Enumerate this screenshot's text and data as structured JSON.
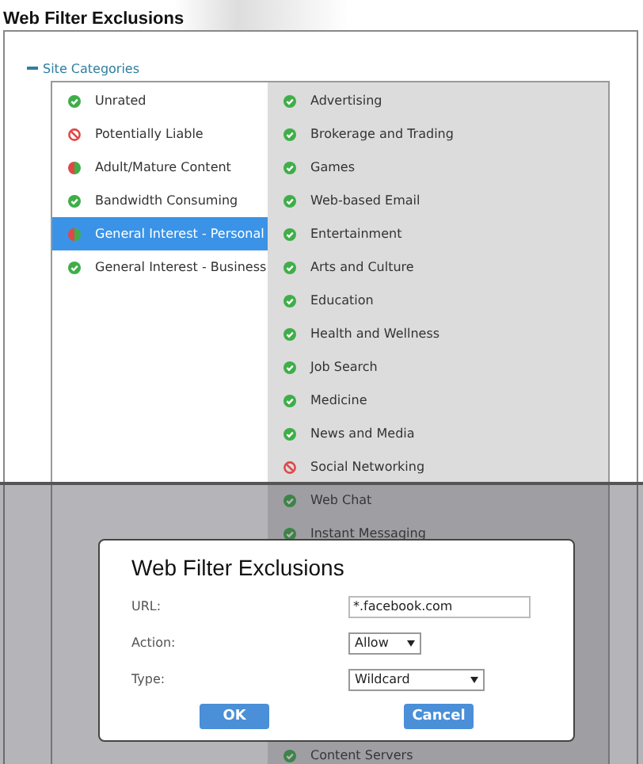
{
  "page_title": "Web Filter Exclusions",
  "section": {
    "title": "Site Categories",
    "expanded": true
  },
  "left_items": [
    {
      "label": "Unrated",
      "kind": "allowed",
      "selected": false
    },
    {
      "label": "Potentially Liable",
      "kind": "blocked",
      "selected": false
    },
    {
      "label": "Adult/Mature Content",
      "kind": "mixed",
      "selected": false
    },
    {
      "label": "Bandwidth Consuming",
      "kind": "allowed",
      "selected": false
    },
    {
      "label": "General Interest - Personal",
      "kind": "mixed",
      "selected": true
    },
    {
      "label": "General Interest - Business",
      "kind": "allowed",
      "selected": false
    }
  ],
  "right_items": [
    {
      "label": "Advertising",
      "kind": "allowed"
    },
    {
      "label": "Brokerage and Trading",
      "kind": "allowed"
    },
    {
      "label": "Games",
      "kind": "allowed"
    },
    {
      "label": "Web-based Email",
      "kind": "allowed"
    },
    {
      "label": "Entertainment",
      "kind": "allowed"
    },
    {
      "label": "Arts and Culture",
      "kind": "allowed"
    },
    {
      "label": "Education",
      "kind": "allowed"
    },
    {
      "label": "Health and Wellness",
      "kind": "allowed"
    },
    {
      "label": "Job Search",
      "kind": "allowed"
    },
    {
      "label": "Medicine",
      "kind": "allowed"
    },
    {
      "label": "News and Media",
      "kind": "allowed"
    },
    {
      "label": "Social Networking",
      "kind": "blocked"
    },
    {
      "label": "Web Chat",
      "kind": "allowed"
    },
    {
      "label": "Instant Messaging",
      "kind": "allowed"
    }
  ],
  "right_items_below_dialog": [
    {
      "label": "Content Servers",
      "kind": "allowed"
    }
  ],
  "dialog": {
    "title": "Web Filter Exclusions",
    "fields": [
      {
        "label": "URL:",
        "kind": "text",
        "value": "*.facebook.com"
      },
      {
        "label": "Action:",
        "kind": "select",
        "value": "Allow"
      },
      {
        "label": "Type:",
        "kind": "select",
        "value": "Wildcard"
      }
    ],
    "buttons": [
      "OK",
      "Cancel"
    ]
  }
}
